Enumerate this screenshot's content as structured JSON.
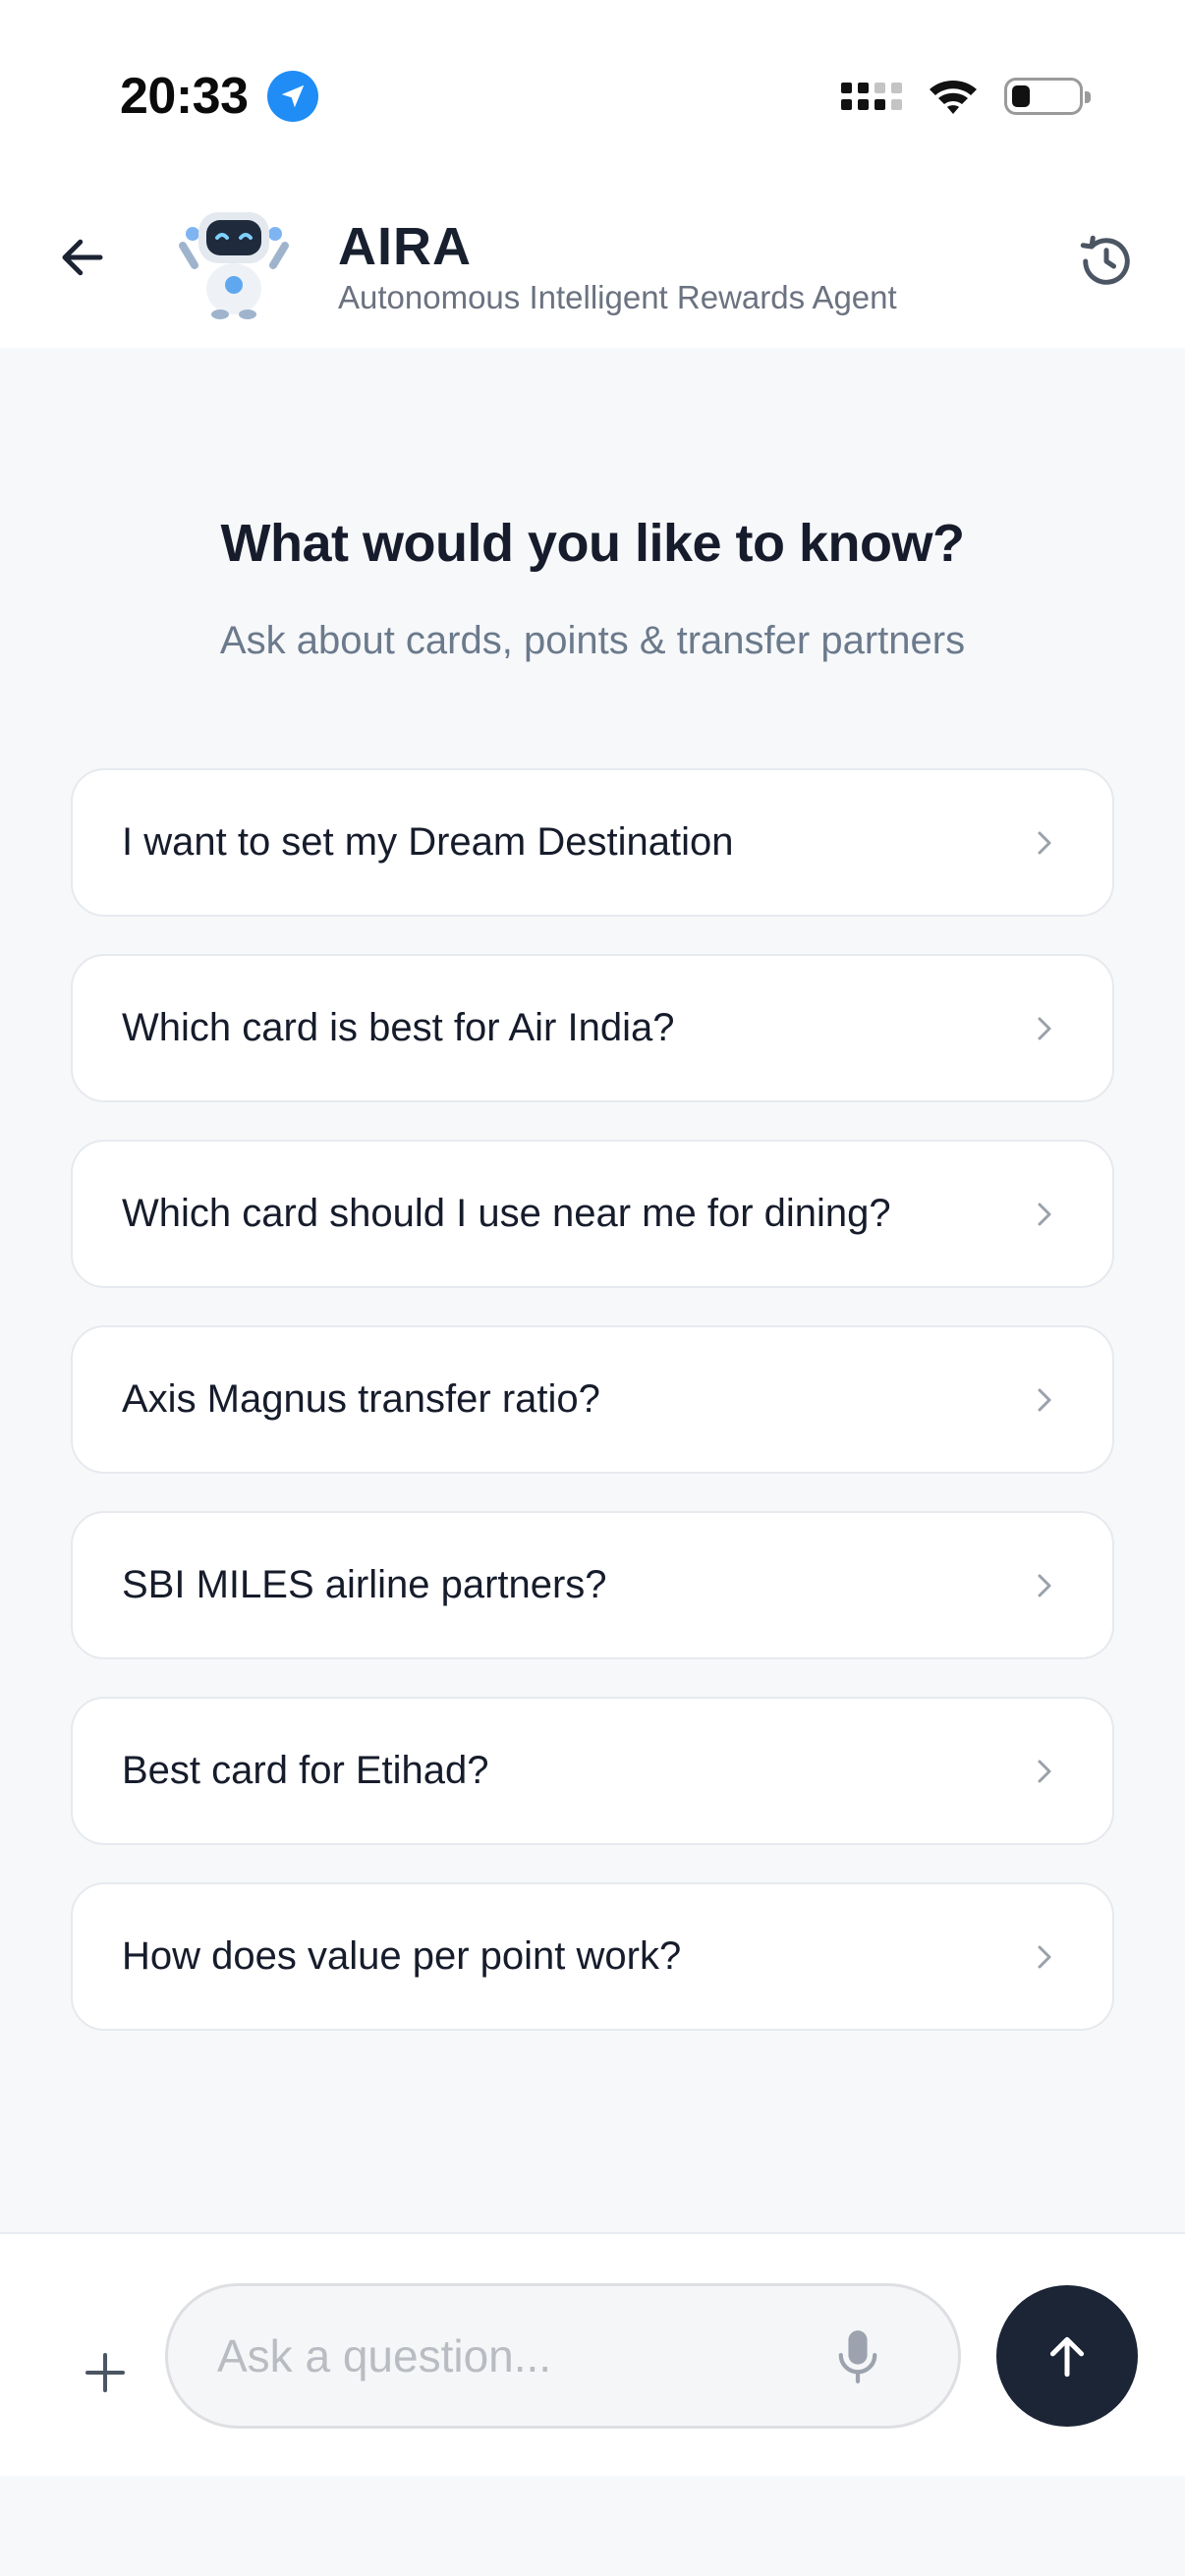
{
  "status_bar": {
    "time": "20:33",
    "location_icon": "location-arrow-icon",
    "signal_icon": "cellular-signal-icon",
    "wifi_icon": "wifi-icon",
    "battery_icon": "battery-icon",
    "battery_level": 0.2
  },
  "header": {
    "back_icon": "arrow-left-icon",
    "avatar": "robot-mascot",
    "title": "AIRA",
    "subtitle": "Autonomous Intelligent Rewards Agent",
    "history_icon": "history-icon"
  },
  "hero": {
    "title": "What would you like to know?",
    "subtitle": "Ask about cards, points & transfer partners"
  },
  "suggestions": [
    {
      "label": "I want to set my Dream Destination"
    },
    {
      "label": "Which card is best for Air India?"
    },
    {
      "label": "Which card should I use near me for dining?"
    },
    {
      "label": "Axis Magnus transfer ratio?"
    },
    {
      "label": "SBI MILES airline partners?"
    },
    {
      "label": "Best card for Etihad?"
    },
    {
      "label": "How does value per point work?"
    }
  ],
  "composer": {
    "placeholder": "Ask a question...",
    "value": "",
    "plus_icon": "plus-icon",
    "mic_icon": "microphone-icon",
    "send_icon": "arrow-up-icon"
  },
  "colors": {
    "background": "#f7f8fa",
    "card": "#ffffff",
    "text_primary": "#161c2b",
    "text_secondary": "#6b7a8c",
    "send_button": "#1b2536",
    "location_badge": "#1f8df5"
  }
}
